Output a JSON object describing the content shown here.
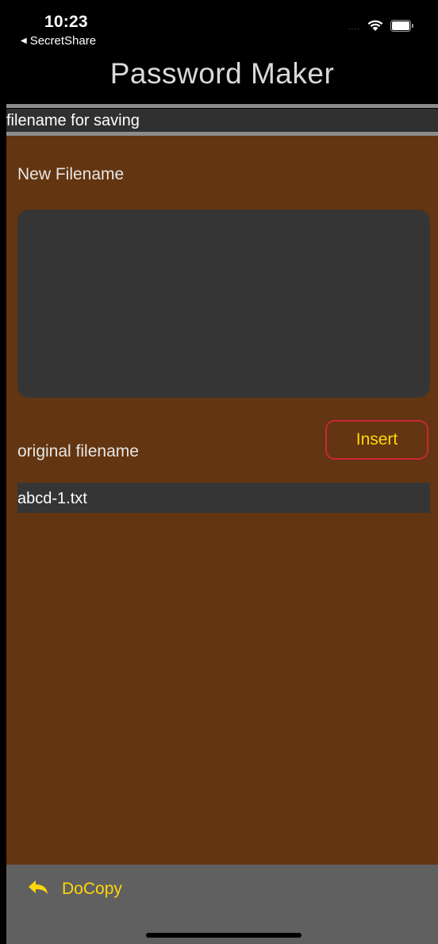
{
  "status_bar": {
    "time": "10:23",
    "back_app_label": "SecretShare",
    "signal_dots": "....",
    "icons": [
      "wifi-icon",
      "battery-icon"
    ]
  },
  "nav": {
    "title": "Password Maker"
  },
  "section": {
    "header": "filename for saving"
  },
  "form": {
    "new_filename_label": "New Filename",
    "new_filename_value": "",
    "original_filename_label": "original filename",
    "original_filename_value": "abcd-1.txt",
    "insert_label": "Insert"
  },
  "toolbar": {
    "docopy_label": "DoCopy",
    "docopy_icon": "reply-arrow-icon"
  },
  "colors": {
    "content_bg": "#633510",
    "accent": "#ffd60a",
    "insert_border": "#c8283a",
    "field_bg": "#353535",
    "toolbar_bg": "#606060"
  }
}
